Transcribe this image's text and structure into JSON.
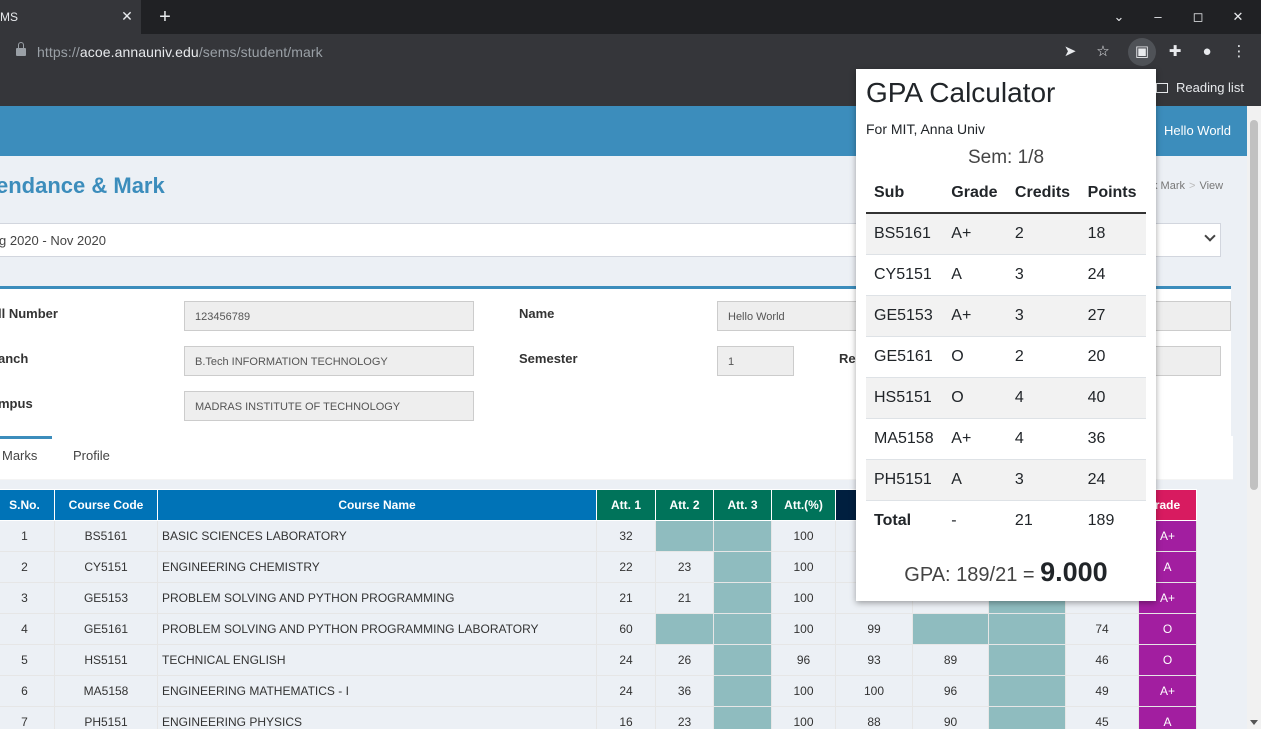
{
  "browser": {
    "tab_title": "MS",
    "url_prefix": "https://",
    "url_host": "acoe.annauniv.edu",
    "url_path": "/sems/student/mark",
    "reading_list": "Reading list"
  },
  "header": {
    "user": "Hello World"
  },
  "page": {
    "title": "endance & Mark",
    "breadcrumb": [
      "k Mark",
      "View"
    ],
    "session_select": "g 2020 - Nov 2020"
  },
  "student": {
    "roll_label": "ll Number",
    "roll_value": "123456789",
    "name_label": "Name",
    "name_value": "Hello World",
    "branch_label": "anch",
    "branch_value": "B.Tech INFORMATION TECHNOLOGY",
    "semester_label": "Semester",
    "semester_value": "1",
    "reg_label": "Re",
    "campus_label": "mpus",
    "campus_value": "MADRAS INSTITUTE OF TECHNOLOGY"
  },
  "tabs": {
    "marks": "Marks",
    "profile": "Profile"
  },
  "marks_table": {
    "headers": [
      "S.No.",
      "Course Code",
      "Course Name",
      "Att. 1",
      "Att. 2",
      "Att. 3",
      "Att.(%)",
      "As",
      "",
      "",
      "",
      "rade"
    ],
    "rows": [
      {
        "sno": "1",
        "code": "BS5161",
        "name": "BASIC SCIENCES LABORATORY",
        "att1": "32",
        "att2": "",
        "att3": "",
        "attp": "100",
        "a1": "",
        "a2": "",
        "a3": "",
        "a4": "",
        "grade": "A+"
      },
      {
        "sno": "2",
        "code": "CY5151",
        "name": "ENGINEERING CHEMISTRY",
        "att1": "22",
        "att2": "23",
        "att3": "",
        "attp": "100",
        "a1": "",
        "a2": "",
        "a3": "",
        "a4": "",
        "grade": "A"
      },
      {
        "sno": "3",
        "code": "GE5153",
        "name": "PROBLEM SOLVING AND PYTHON PROGRAMMING",
        "att1": "21",
        "att2": "21",
        "att3": "",
        "attp": "100",
        "a1": "",
        "a2": "",
        "a3": "",
        "a4": "",
        "grade": "A+"
      },
      {
        "sno": "4",
        "code": "GE5161",
        "name": "PROBLEM SOLVING AND PYTHON PROGRAMMING LABORATORY",
        "att1": "60",
        "att2": "",
        "att3": "",
        "attp": "100",
        "a1": "99",
        "a2": "",
        "a3": "",
        "a4": "74",
        "grade": "O"
      },
      {
        "sno": "5",
        "code": "HS5151",
        "name": "TECHNICAL ENGLISH",
        "att1": "24",
        "att2": "26",
        "att3": "",
        "attp": "96",
        "a1": "93",
        "a2": "89",
        "a3": "",
        "a4": "46",
        "grade": "O"
      },
      {
        "sno": "6",
        "code": "MA5158",
        "name": "ENGINEERING MATHEMATICS - I",
        "att1": "24",
        "att2": "36",
        "att3": "",
        "attp": "100",
        "a1": "100",
        "a2": "96",
        "a3": "",
        "a4": "49",
        "grade": "A+"
      },
      {
        "sno": "7",
        "code": "PH5151",
        "name": "ENGINEERING PHYSICS",
        "att1": "16",
        "att2": "23",
        "att3": "",
        "attp": "100",
        "a1": "88",
        "a2": "90",
        "a3": "",
        "a4": "45",
        "grade": "A"
      }
    ]
  },
  "gpa_popup": {
    "title": "GPA Calculator",
    "subtitle": "For MIT, Anna Univ",
    "sem": "Sem: 1/8",
    "headers": [
      "Sub",
      "Grade",
      "Credits",
      "Points"
    ],
    "rows": [
      {
        "sub": "BS5161",
        "grade": "A+",
        "credits": "2",
        "points": "18"
      },
      {
        "sub": "CY5151",
        "grade": "A",
        "credits": "3",
        "points": "24"
      },
      {
        "sub": "GE5153",
        "grade": "A+",
        "credits": "3",
        "points": "27"
      },
      {
        "sub": "GE5161",
        "grade": "O",
        "credits": "2",
        "points": "20"
      },
      {
        "sub": "HS5151",
        "grade": "O",
        "credits": "4",
        "points": "40"
      },
      {
        "sub": "MA5158",
        "grade": "A+",
        "credits": "4",
        "points": "36"
      },
      {
        "sub": "PH5151",
        "grade": "A",
        "credits": "3",
        "points": "24"
      }
    ],
    "total": {
      "sub": "Total",
      "grade": "-",
      "credits": "21",
      "points": "189"
    },
    "gpa_prefix": "GPA: 189/21 = ",
    "gpa_value": "9.000"
  },
  "colors": {
    "header_blue": "#3c8dbc",
    "th_blue": "#0073b7",
    "th_green": "#00735a",
    "grade_purple": "#a21ea0",
    "grade_header": "#d81b60"
  }
}
